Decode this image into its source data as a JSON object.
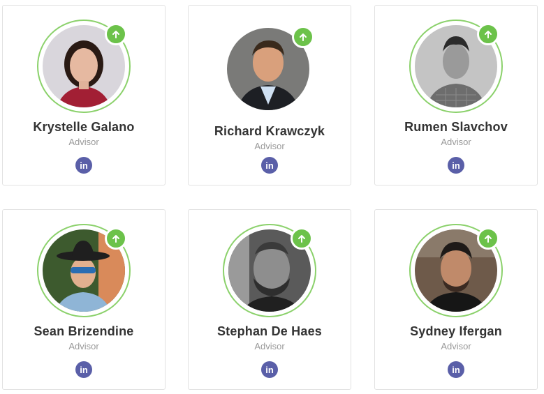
{
  "team": [
    {
      "name": "Krystelle Galano",
      "role": "Advisor",
      "social": "in",
      "photo": "portrait-woman-red-top"
    },
    {
      "name": "Richard Krawczyk",
      "role": "Advisor",
      "social": "in",
      "photo": "portrait-man-suit-grey"
    },
    {
      "name": "Rumen Slavchov",
      "role": "Advisor",
      "social": "in",
      "photo": "portrait-man-bw-checked-shirt"
    },
    {
      "name": "Sean Brizendine",
      "role": "Advisor",
      "social": "in",
      "photo": "portrait-man-cowboy-hat-sunglasses"
    },
    {
      "name": "Stephan De Haes",
      "role": "Advisor",
      "social": "in",
      "photo": "portrait-man-bw-beard"
    },
    {
      "name": "Sydney Ifergan",
      "role": "Advisor",
      "social": "in",
      "photo": "portrait-man-dark-shirt"
    }
  ],
  "colors": {
    "badge": "#6cc24a",
    "ring": "#8bd16b",
    "linkedin": "#5a5fa8",
    "name": "#333333",
    "role": "#999999"
  }
}
